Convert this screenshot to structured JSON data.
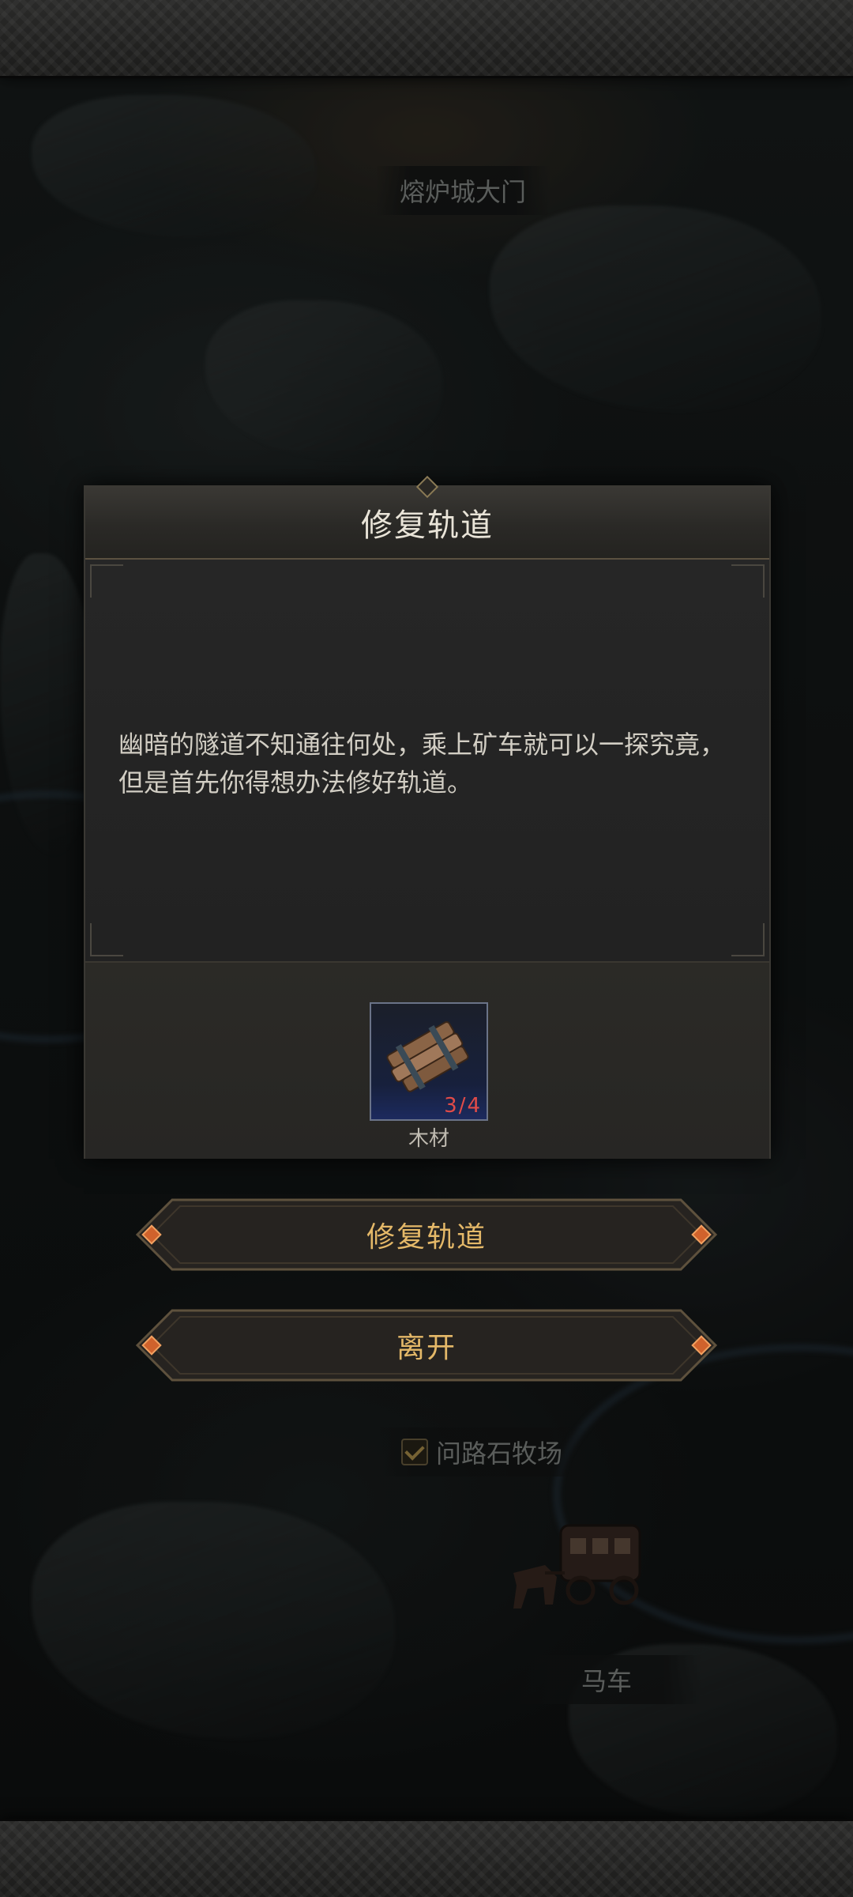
{
  "map": {
    "gate_label": "熔炉城大门",
    "pasture_label": "问路石牧场",
    "wagon_label": "马车"
  },
  "dialog": {
    "title": "修复轨道",
    "description": "幽暗的隧道不知通往何处，乘上矿车就可以一探究竟，但是首先你得想办法修好轨道。",
    "item": {
      "icon": "wood-planks-icon",
      "count": "3/4",
      "name": "木材",
      "count_color": "#e04b48"
    }
  },
  "actions": {
    "repair_label": "修复轨道",
    "leave_label": "离开",
    "label_color": "#e4b868"
  }
}
